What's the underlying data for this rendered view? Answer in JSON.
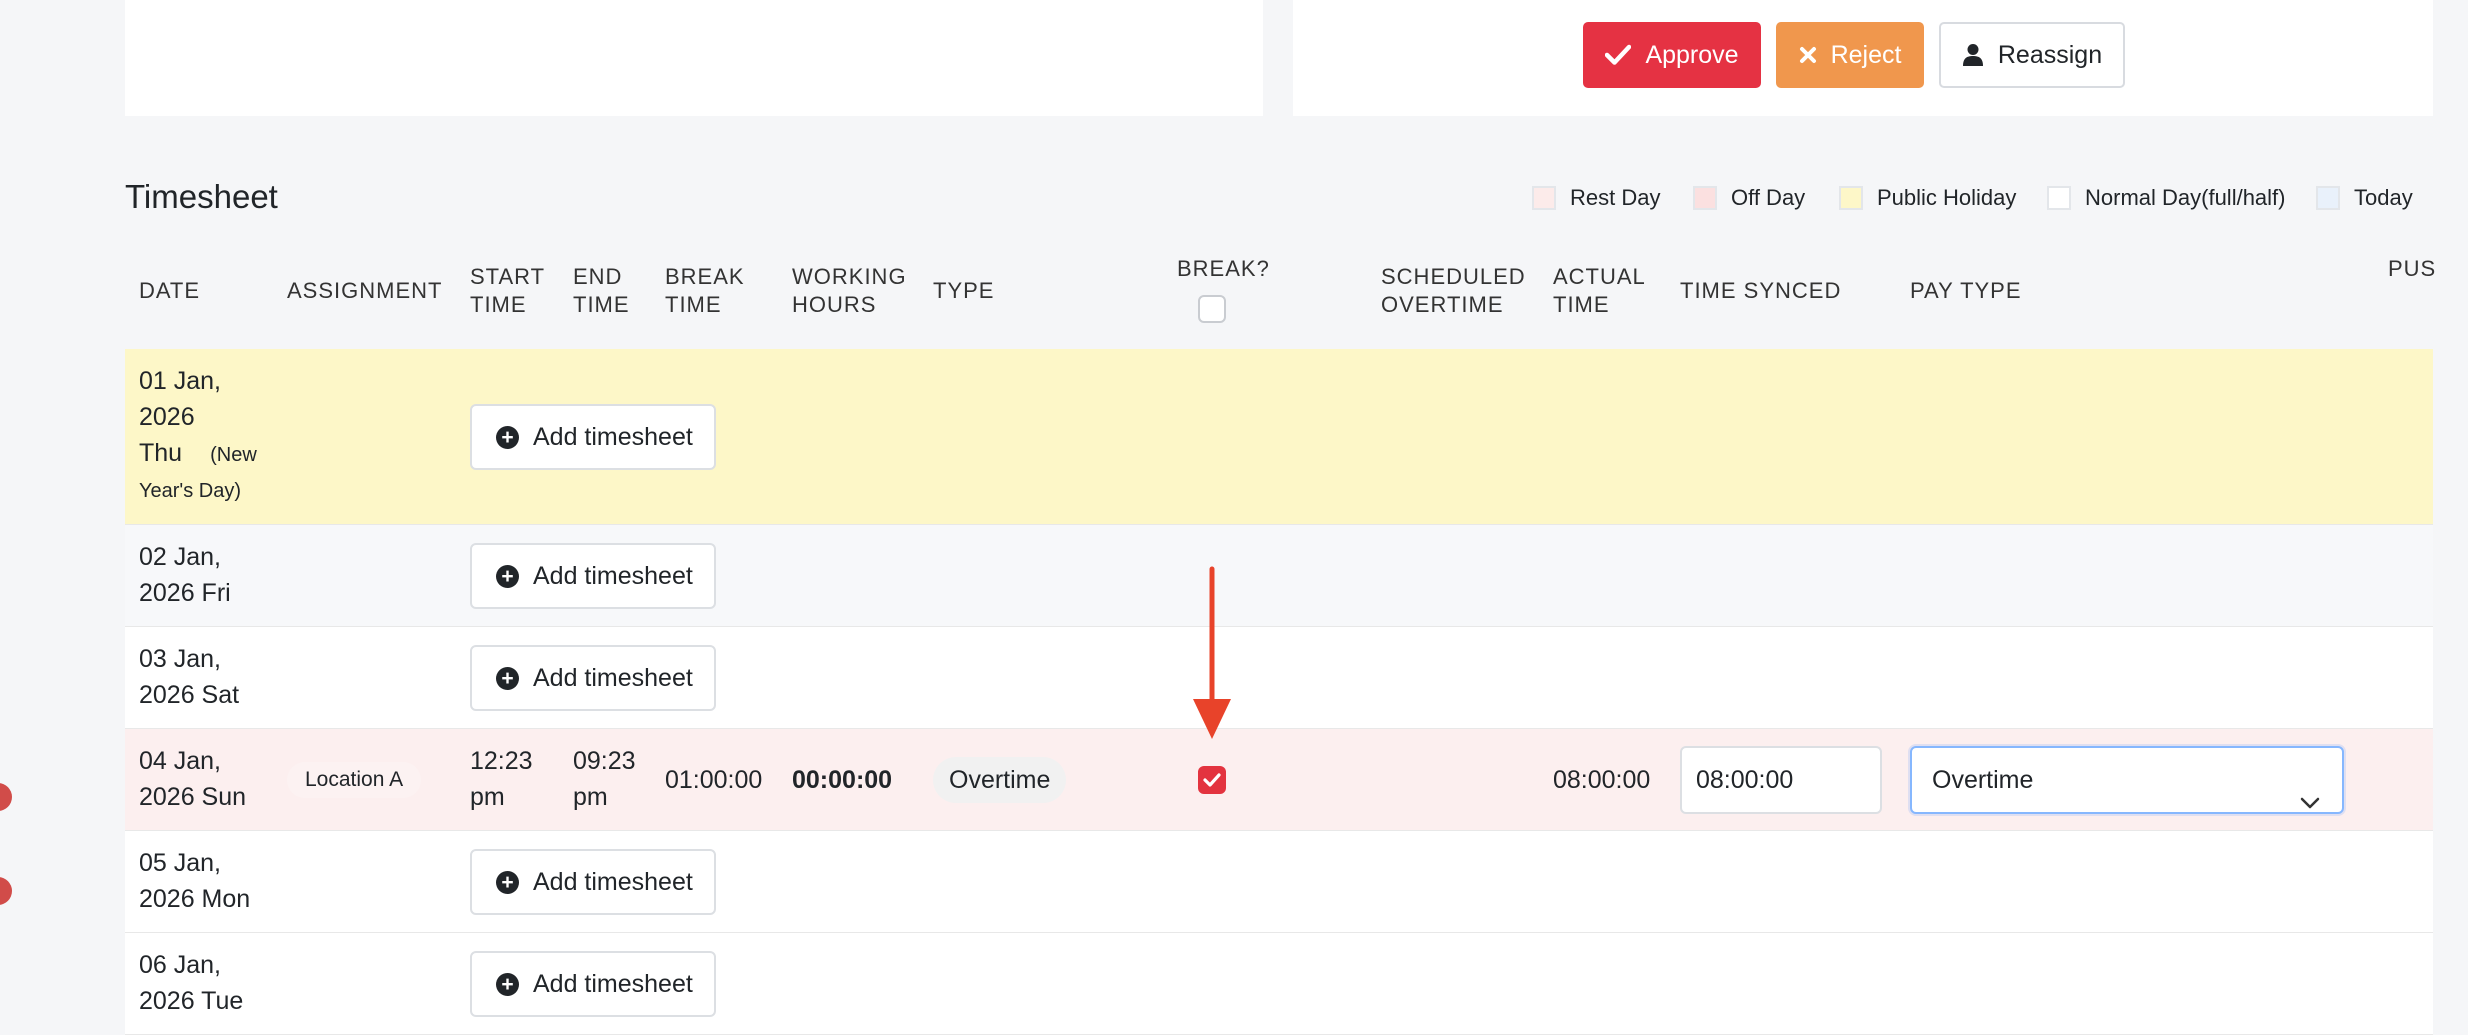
{
  "actions": {
    "approve_label": "Approve",
    "reject_label": "Reject",
    "reassign_label": "Reassign"
  },
  "section_title": "Timesheet",
  "legend": [
    {
      "label": "Rest Day",
      "color": "#fcebea"
    },
    {
      "label": "Off Day",
      "color": "#fbe0e0"
    },
    {
      "label": "Public Holiday",
      "color": "#fdf7c8"
    },
    {
      "label": "Normal Day(full/half)",
      "color": "#ffffff"
    },
    {
      "label": "Today",
      "color": "#e9f1fb"
    }
  ],
  "columns": {
    "date": "DATE",
    "assignment": "ASSIGNMENT",
    "start_time_1": "START",
    "start_time_2": "TIME",
    "end_time_1": "END",
    "end_time_2": "TIME",
    "break_time_1": "BREAK",
    "break_time_2": "TIME",
    "working_hours_1": "WORKING",
    "working_hours_2": "HOURS",
    "type": "TYPE",
    "break": "BREAK?",
    "scheduled_overtime_1": "SCHEDULED",
    "scheduled_overtime_2": "OVERTIME",
    "actual_time_1": "ACTUAL",
    "actual_time_2": "TIME",
    "time_synced": "TIME SYNCED",
    "pay_type": "PAY TYPE",
    "push": "PUS"
  },
  "add_label": "Add timesheet",
  "rows": [
    {
      "date_1": "01 Jan,",
      "date_2": "2026",
      "date_3": "Thu",
      "holiday_1": "(New",
      "holiday_2": "Year's Day)"
    },
    {
      "date_1": "02 Jan,",
      "date_2": "2026 Fri"
    },
    {
      "date_1": "03 Jan,",
      "date_2": "2026 Sat"
    },
    {
      "date_1": "04 Jan,",
      "date_2": "2026 Sun",
      "assignment": "Location A",
      "start_1": "12:23",
      "start_2": "pm",
      "end_1": "09:23",
      "end_2": "pm",
      "break_time": "01:00:00",
      "working_hours": "00:00:00",
      "type": "Overtime",
      "break_checked": true,
      "actual_time": "08:00:00",
      "time_synced": "08:00:00",
      "pay_type": "Overtime"
    },
    {
      "date_1": "05 Jan,",
      "date_2": "2026 Mon"
    },
    {
      "date_1": "06 Jan,",
      "date_2": "2026 Tue"
    }
  ],
  "colors": {
    "approve": "#e53243",
    "reject": "#f0974d",
    "holiday_row": "#fdf7c8",
    "weekend_row": "#f7f8fa",
    "highlight_row": "#fcefef",
    "arrow": "#e8432a"
  }
}
